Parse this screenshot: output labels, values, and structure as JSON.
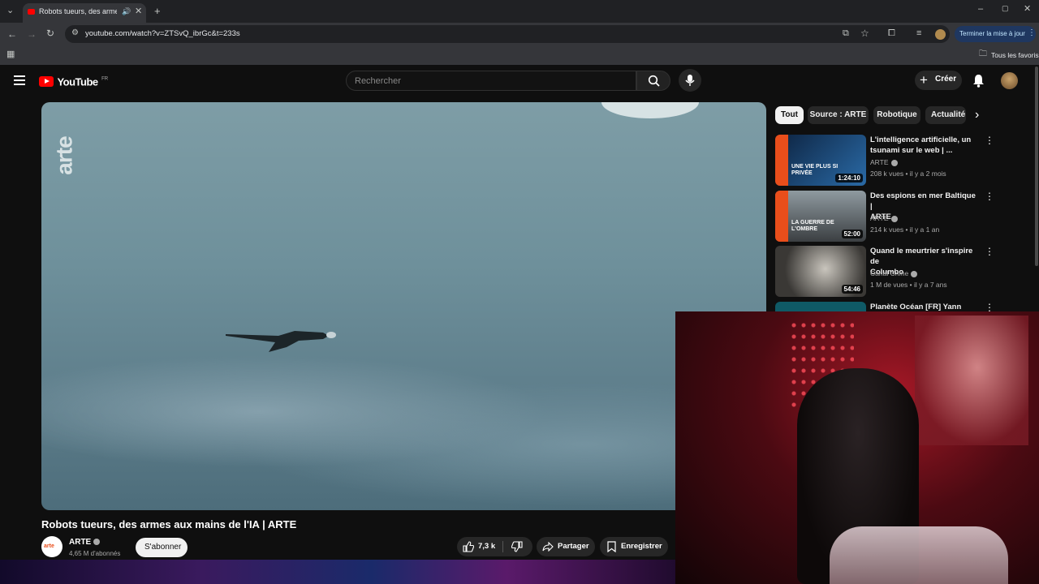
{
  "browser": {
    "tab_title": "Robots tueurs, des armes a",
    "url": "youtube.com/watch?v=ZTSvQ_ibrGc&t=233s",
    "update_button": "Terminer la mise à jour",
    "bookmarks_all": "Tous les favoris"
  },
  "header": {
    "logo_text": "YouTube",
    "logo_region": "FR",
    "search_placeholder": "Rechercher",
    "create_label": "Créer"
  },
  "video": {
    "watermark": "arte",
    "title": "Robots tueurs, des armes aux mains de l'IA | ARTE",
    "channel": "ARTE",
    "subscribers": "4,65 M d'abonnés",
    "subscribe_label": "S'abonner",
    "likes": "7,3 k",
    "share_label": "Partager",
    "save_label": "Enregistrer"
  },
  "chips": [
    "Tout",
    "Source : ARTE",
    "Robotique",
    "Actualité"
  ],
  "recommendations": [
    {
      "title_line1": "L'intelligence artificielle, un",
      "title_line2": "tsunami sur le web | ...",
      "channel": "ARTE",
      "meta": "208 k vues • il y a 2 mois",
      "duration": "1:24:10",
      "thumb_text": "UNE VIE PLUS SI PRIVÉE",
      "thumb_color": "#1a3c63"
    },
    {
      "title_line1": "Des espions en mer Baltique |",
      "title_line2": "ARTE",
      "channel": "ARTE",
      "meta": "214 k vues • il y a 1 an",
      "duration": "52:00",
      "thumb_text": "LA GUERRE DE L'OMBRE",
      "thumb_color": "#5a5f63"
    },
    {
      "title_line1": "Quand le meurtrier s'inspire de",
      "title_line2": "Columbo",
      "channel": "Canal Crime",
      "meta": "1 M de vues • il y a 7 ans",
      "duration": "54:46",
      "thumb_text": "",
      "thumb_color": "#6f6d6a"
    },
    {
      "title_line1": "Planète Océan [FR] Yann",
      "title_line2": "",
      "channel": "",
      "meta": "",
      "duration": "",
      "thumb_text": "",
      "thumb_color": "#0f5a66"
    }
  ],
  "colors": {
    "brand_red": "#ff0000",
    "arte_orange": "#e94e1b",
    "accent_blue": "#3ea6ff"
  },
  "icons": [
    "menu-icon",
    "search-icon",
    "mic-icon",
    "plus-icon",
    "bell-icon",
    "thumb-up-icon",
    "thumb-down-icon",
    "share-icon",
    "bookmark-icon",
    "chevron-right-icon",
    "more-vert-icon"
  ]
}
